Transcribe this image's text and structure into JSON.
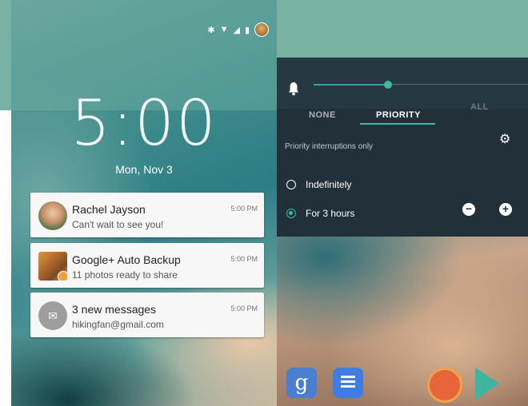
{
  "left_phone": {
    "status": {
      "bluetooth_icon": "bluetooth-icon",
      "wifi_icon": "wifi-icon",
      "signal_icon": "signal-icon",
      "battery_icon": "battery-icon"
    },
    "clock": "5:00",
    "date": "Mon, Nov 3",
    "notifications": [
      {
        "title": "Rachel Jayson",
        "subtitle": "Can't wait to see you!",
        "time": "5:00 PM",
        "icon": "contact-photo"
      },
      {
        "title": "Google+ Auto Backup",
        "subtitle": "11 photos ready to share",
        "time": "5:00 PM",
        "icon": "photo-thumbnail"
      },
      {
        "title": "3 new messages",
        "subtitle": "hikingfan@gmail.com",
        "time": "5:00 PM",
        "icon": "gmail-icon"
      }
    ]
  },
  "right_phone": {
    "volume_level": 0.33,
    "tabs": {
      "none": "NONE",
      "priority": "PRIORITY",
      "all": "ALL",
      "selected": "PRIORITY"
    },
    "description": "Priority interruptions only",
    "options": {
      "indefinitely": "Indefinitely",
      "for_hours": "For 3 hours",
      "selected": "For 3 hours"
    },
    "decrease_symbol": "−",
    "increase_symbol": "+",
    "gear_symbol": "⚙",
    "dock_apps": [
      "google-search-app",
      "docs-app",
      "hangouts-app",
      "play-store-app"
    ],
    "google_letter": "g"
  },
  "colors": {
    "accent": "#3fb6a8",
    "banner": "#79b2a2",
    "panel": "#223039"
  }
}
